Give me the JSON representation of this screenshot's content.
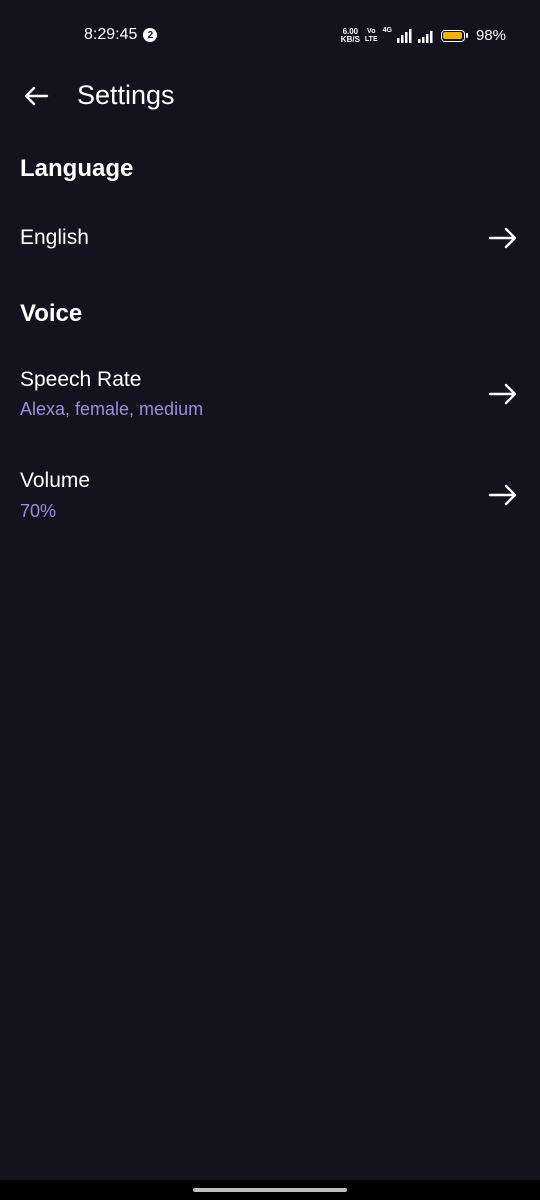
{
  "status": {
    "time": "8:29:45",
    "notif_count": "2",
    "net_speed_value": "6.00",
    "net_speed_unit": "KB/S",
    "volte_top": "Vo",
    "volte_bottom": "LTE",
    "network_type": "4G",
    "battery_level": 0.98,
    "battery_pct": "98%",
    "battery_color": "#f2b400"
  },
  "header": {
    "title": "Settings"
  },
  "sections": {
    "language": {
      "title": "Language",
      "item_label": "English"
    },
    "voice": {
      "title": "Voice",
      "speech_rate_label": "Speech Rate",
      "speech_rate_value": "Alexa, female, medium",
      "volume_label": "Volume",
      "volume_value": "70%"
    }
  },
  "colors": {
    "background": "#14121f",
    "accent_subtext": "#9b8fd6"
  }
}
